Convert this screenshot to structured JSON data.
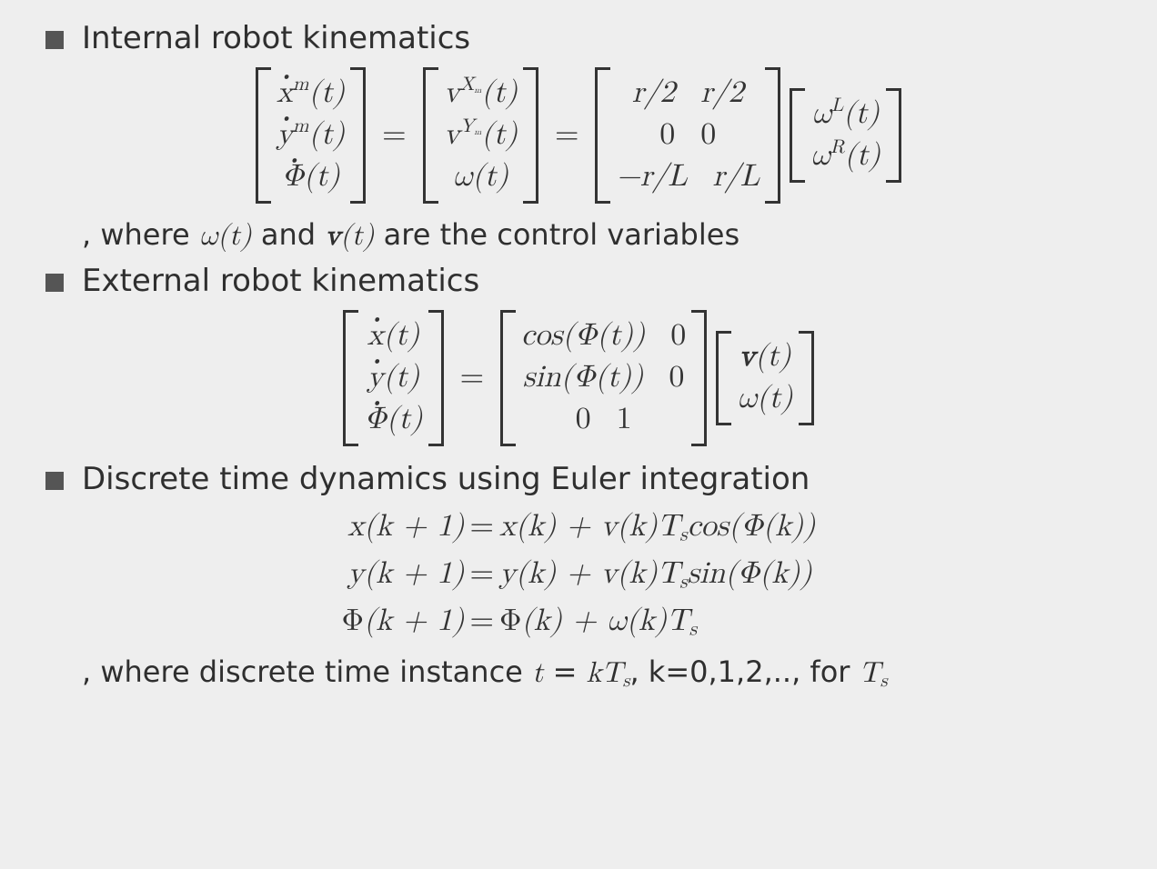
{
  "bullets": {
    "b1": "Internal robot kinematics",
    "b2": "External robot kinematics",
    "b3": "Discrete time dynamics using Euler integration"
  },
  "note1_a": ", where ",
  "note1_om": "ω(t)",
  "note1_b": " and ",
  "note1_v": "v",
  "note1_vt": "(t)",
  "note1_c": " are the control variables",
  "note2_a": ", where discrete time instance ",
  "note2_eq_l": "t",
  "note2_eq_m": " = ",
  "note2_eq_r": "kT",
  "note2_eq_sub": "s",
  "note2_b": ", k=0,1,2,.., for ",
  "note2_ts": "T",
  "note2_ts_sub": "s",
  "eq1": {
    "col1": {
      "r1a": "x",
      "r1s": "m",
      "r1t": "(t)",
      "r2a": "y",
      "r2s": "m",
      "r2t": "(t)",
      "r3": "Φ(t)"
    },
    "col2": {
      "r1a": "v",
      "r1s": "X",
      "r1ss": "m",
      "r1t": "(t)",
      "r2a": "v",
      "r2s": "Y",
      "r2ss": "m",
      "r2t": "(t)",
      "r3": "ω(t)"
    },
    "col3": {
      "r1c1": "r/2",
      "r1c2": "r/2",
      "r2c1": "0",
      "r2c2": "0",
      "r3c1": "−r/L",
      "r3c2": "r/L"
    },
    "col4": {
      "r1a": "ω",
      "r1s": "L",
      "r1t": "(t)",
      "r2a": "ω",
      "r2s": "R",
      "r2t": "(t)"
    },
    "eq": "="
  },
  "eq2": {
    "col1": {
      "r1": "x(t)",
      "r2": "y(t)",
      "r3": "Φ(t)"
    },
    "col2": {
      "r1c1": "cos(Φ(t))",
      "r1c2": "0",
      "r2c1": "sin(Φ(t))",
      "r2c2": "0",
      "r3c1": "0",
      "r3c2": "1"
    },
    "col3": {
      "r1a": "v",
      "r1t": "(t)",
      "r2": "ω(t)"
    },
    "eq": "="
  },
  "eq3": {
    "l1_lhs": "x(k + 1)",
    "l1_rhs": "x(k) + v(k)T",
    "l1_sub": "s",
    "l1_tail": "cos(Φ(k))",
    "l2_lhs": "y(k + 1)",
    "l2_rhs": "y(k) + v(k)T",
    "l2_sub": "s",
    "l2_tail": "sin(Φ(k))",
    "l3_lhs": "Φ(k + 1)",
    "l3_rhs": "Φ(k) + ω(k)T",
    "l3_sub": "s",
    "eq": "="
  }
}
